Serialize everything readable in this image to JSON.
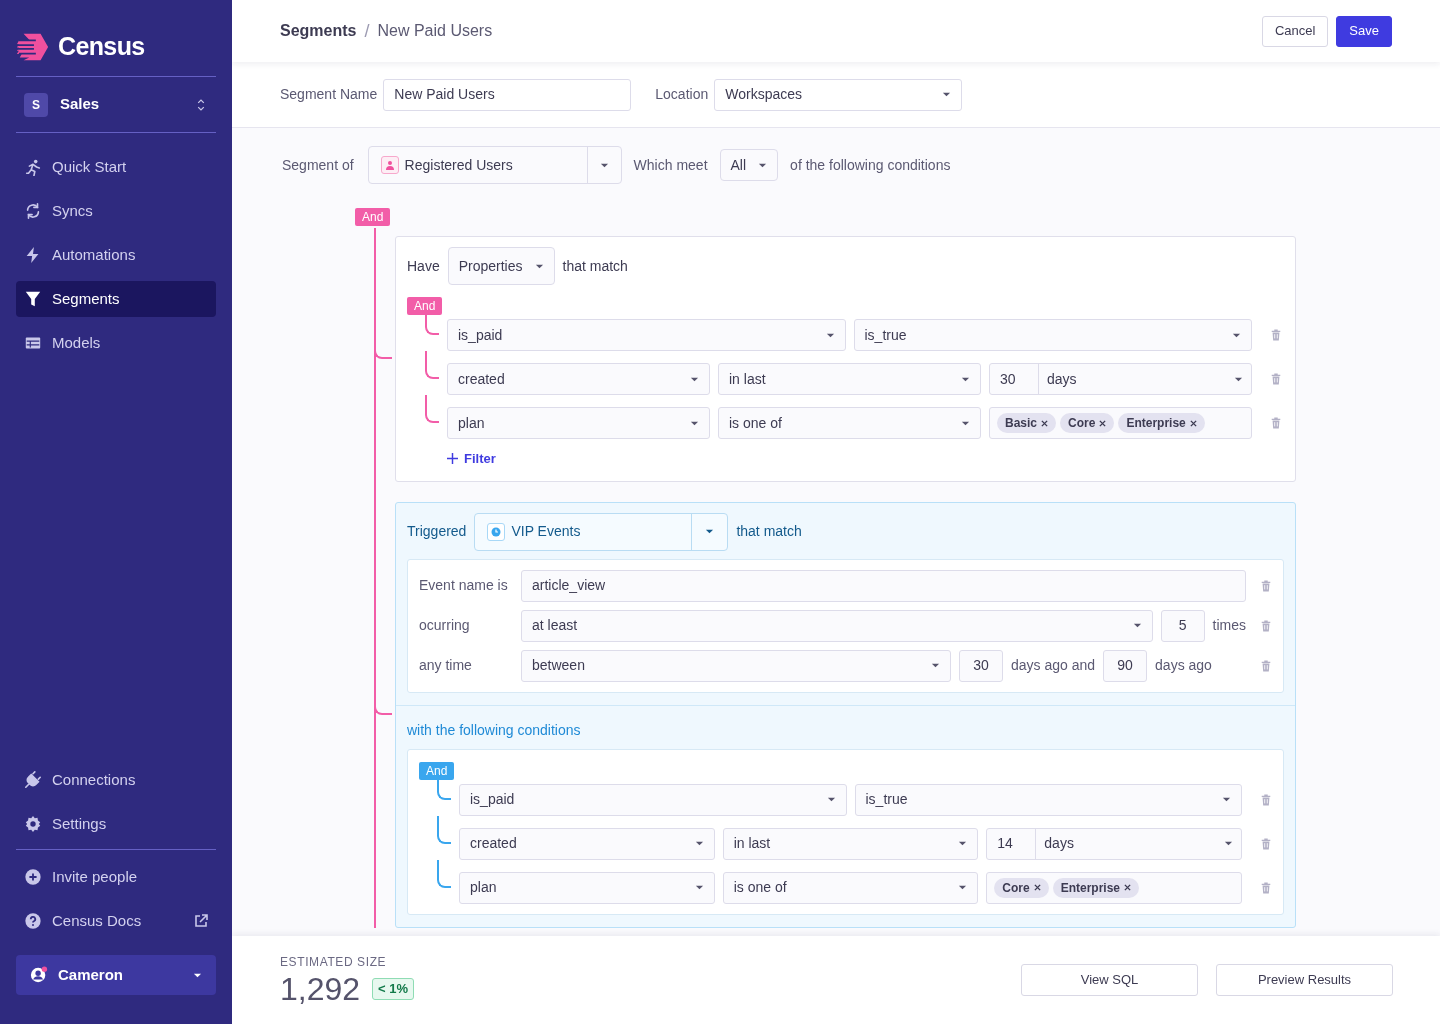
{
  "sidebar": {
    "logo": "Census",
    "workspace": {
      "initial": "S",
      "name": "Sales"
    },
    "nav": [
      {
        "label": "Quick Start",
        "kind": "runner",
        "selected": false
      },
      {
        "label": "Syncs",
        "kind": "sync",
        "selected": false
      },
      {
        "label": "Automations",
        "kind": "bolt",
        "selected": false
      },
      {
        "label": "Segments",
        "kind": "funnel",
        "selected": true
      },
      {
        "label": "Models",
        "kind": "table",
        "selected": false
      }
    ],
    "bottom_nav": [
      {
        "label": "Connections",
        "kind": "plug"
      },
      {
        "label": "Settings",
        "kind": "gear"
      }
    ],
    "links": [
      {
        "label": "Invite people",
        "kind": "plus",
        "external": false
      },
      {
        "label": "Census Docs",
        "kind": "help",
        "external": true
      }
    ],
    "user": {
      "name": "Cameron"
    }
  },
  "header": {
    "breadcrumb": [
      "Segments",
      "New Paid Users"
    ],
    "breadcrumb_separator": "/",
    "buttons": [
      {
        "label": "Cancel",
        "kind": "secondary"
      },
      {
        "label": "Save",
        "kind": "primary"
      }
    ]
  },
  "segment_name": {
    "label": "Segment Name",
    "value": "New Paid Users"
  },
  "location": {
    "label": "Location",
    "value": "Workspaces"
  },
  "segment_of": {
    "label": "Segment of",
    "value": "Registered Users",
    "which_meet": "Which meet",
    "match": "All",
    "suffix": "of the following conditions"
  },
  "root_operator": "And",
  "groups": [
    {
      "kind": "properties",
      "prefix": "Have",
      "type": "Properties",
      "suffix": "that match",
      "operator": "And",
      "rows": [
        {
          "kind": "boolean",
          "field": "is_paid",
          "operator": "is_true"
        },
        {
          "kind": "relative_date",
          "field": "created",
          "operator": "in last",
          "amount": "30",
          "unit": "days"
        },
        {
          "kind": "one_of",
          "field": "plan",
          "operator": "is one of",
          "tags": [
            "Basic",
            "Core",
            "Enterprise"
          ]
        }
      ],
      "add_filter": "Filter"
    },
    {
      "kind": "events",
      "prefix": "Triggered",
      "source": "VIP Events",
      "suffix": "that match",
      "event_rows": [
        {
          "kind": "text",
          "label": "Event name is",
          "value": "article_view"
        },
        {
          "kind": "count",
          "label": "ocurring",
          "operator": "at least",
          "amount": "5",
          "unit": "times"
        },
        {
          "kind": "range",
          "label": "any time",
          "operator": "between",
          "from": "30",
          "middle": "days ago and",
          "to": "90",
          "unit": "days ago"
        }
      ],
      "conditions_title": "with the following conditions",
      "operator": "And",
      "rows": [
        {
          "kind": "boolean",
          "field": "is_paid",
          "operator": "is_true"
        },
        {
          "kind": "relative_date",
          "field": "created",
          "operator": "in last",
          "amount": "14",
          "unit": "days"
        },
        {
          "kind": "one_of",
          "field": "plan",
          "operator": "is one of",
          "tags": [
            "Core",
            "Enterprise"
          ]
        }
      ]
    }
  ],
  "footer": {
    "label": "ESTIMATED SIZE",
    "value": "1,292",
    "badge": "< 1%",
    "buttons": [
      "View SQL",
      "Preview Results"
    ]
  }
}
